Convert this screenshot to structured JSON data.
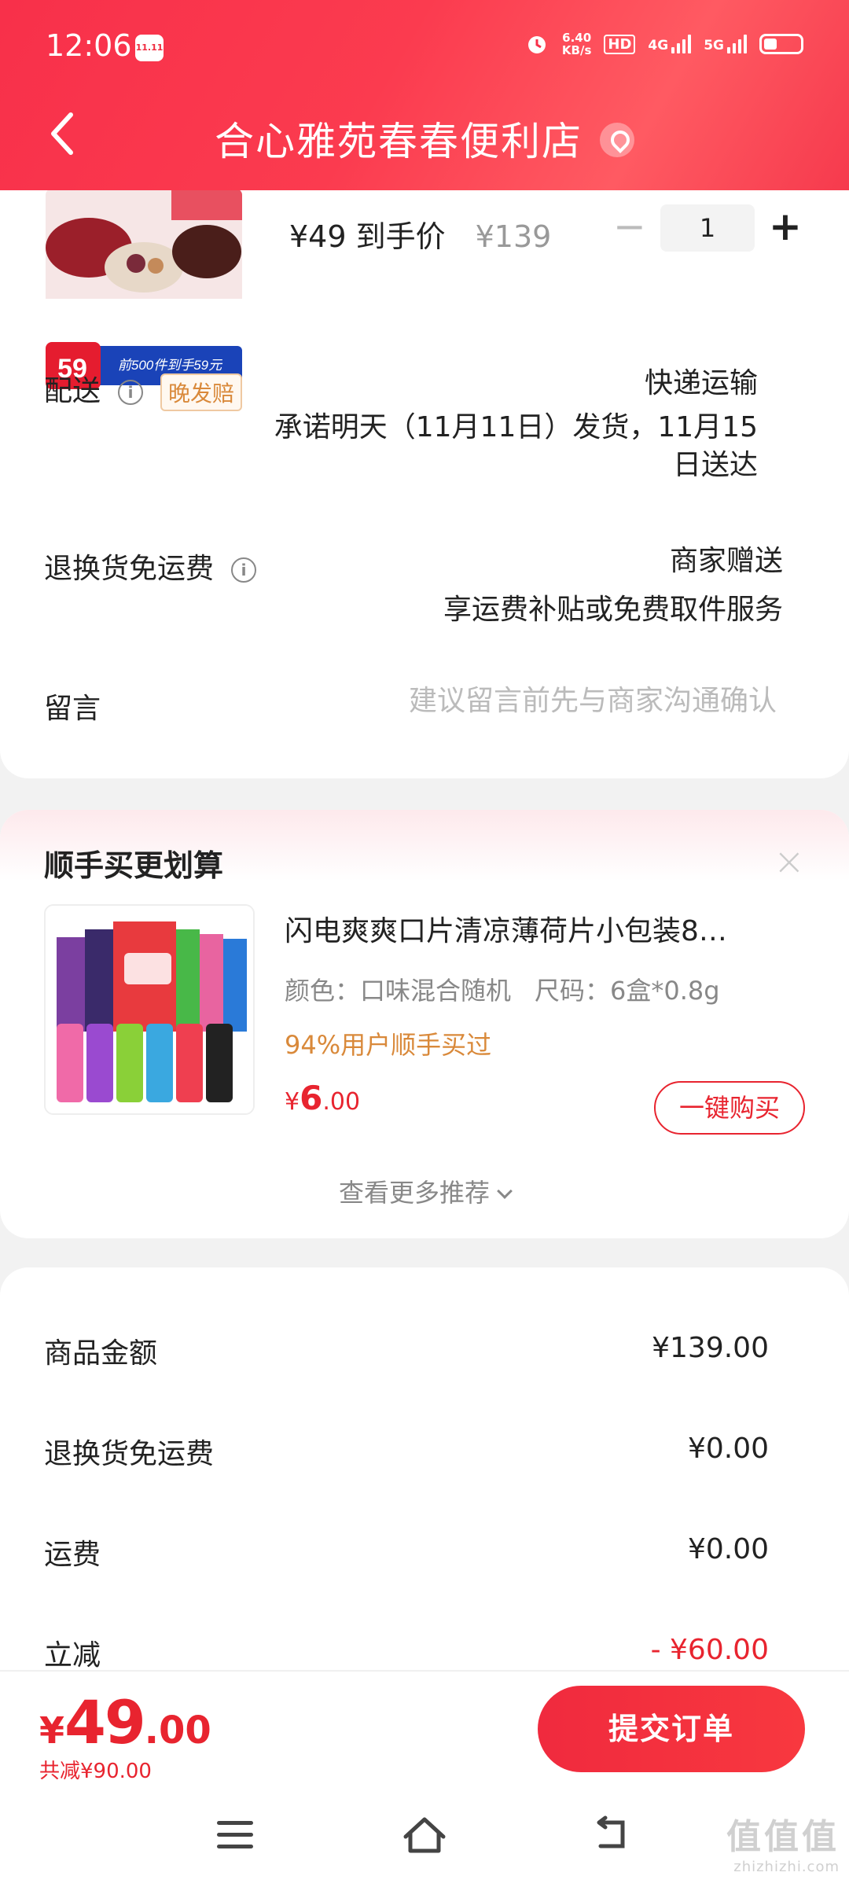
{
  "status_bar": {
    "time": "12:06",
    "app_badge": "11.11",
    "net_speed_top": "6.40",
    "net_speed_bottom": "KB/s",
    "hd": "HD",
    "net1": "4G",
    "net2": "5G"
  },
  "header": {
    "title": "合心雅苑春春便利店"
  },
  "product": {
    "badge_price": "59",
    "promo_text": "前500件到手59元",
    "price_line": "¥49 到手价",
    "original_price": "¥139",
    "quantity": "1",
    "minus": "−",
    "plus": "+"
  },
  "delivery": {
    "label": "配送",
    "tag": "晚发赔",
    "method": "快递运输",
    "promise_line1": "承诺明天（11月11日）发货，11月15",
    "promise_line2": "日送达"
  },
  "return_shipping": {
    "label": "退换货免运费",
    "line1": "商家赠送",
    "line2": "享运费补贴或免费取件服务"
  },
  "message": {
    "label": "留言",
    "placeholder": "建议留言前先与商家沟通确认"
  },
  "recommend": {
    "title": "顺手买更划算",
    "close": "×",
    "item": {
      "name": "闪电爽爽口片清凉薄荷片小包装8…",
      "color": "颜色：口味混合随机",
      "size": "尺码：6盒*0.8g",
      "social": "94%用户顺手买过",
      "price_yen": "¥",
      "price_int": "6",
      "price_dec": ".00",
      "buy_label": "一键购买"
    },
    "more": "查看更多推荐"
  },
  "summary": {
    "rows": [
      {
        "label": "商品金额",
        "value": "¥139.00"
      },
      {
        "label": "退换货免运费",
        "value": "¥0.00"
      },
      {
        "label": "运费",
        "value": "¥0.00"
      },
      {
        "label": "立减",
        "value": "- ¥60.00"
      }
    ]
  },
  "bottom": {
    "yen": "¥",
    "total_int": "49",
    "total_dec": ".00",
    "saved": "共减¥90.00",
    "submit": "提交订单"
  },
  "watermark": {
    "main": "值值值",
    "sub": "zhizhizhi.com"
  },
  "colors": {
    "brand_red": "#f02a3e",
    "price_red": "#e8242f",
    "accent_orange": "#d9893a"
  }
}
